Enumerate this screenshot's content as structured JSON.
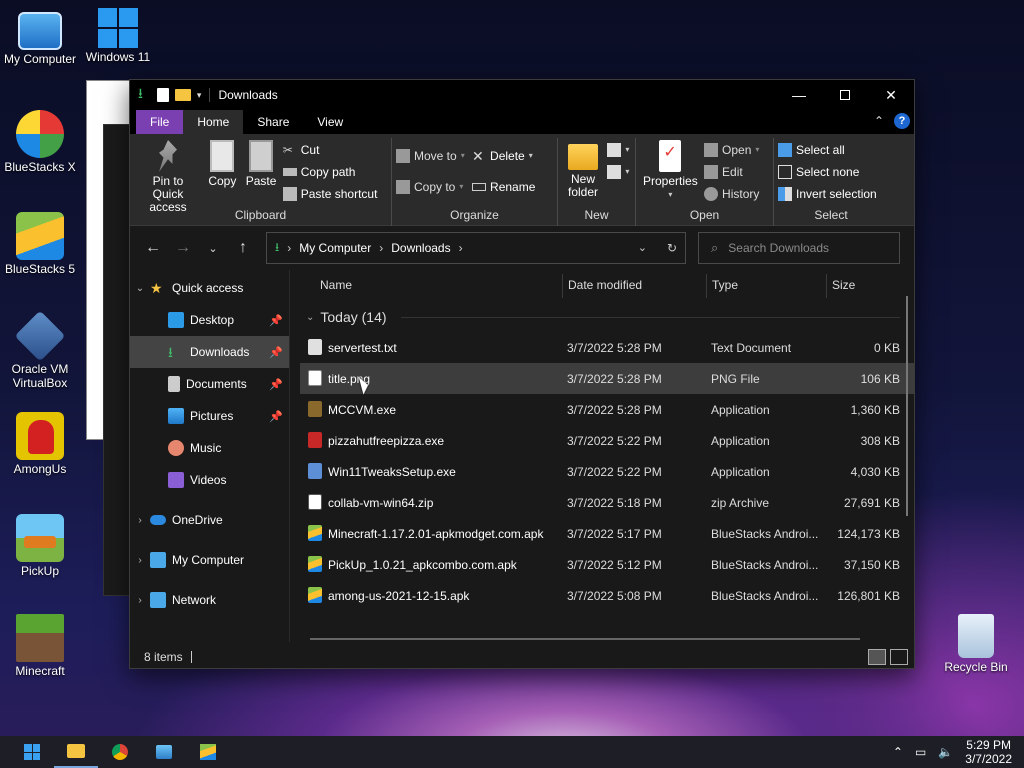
{
  "desktop": {
    "icons": [
      {
        "label": "My Computer",
        "icon": "monitor-icon"
      },
      {
        "label": "Windows 11",
        "icon": "windows-logo-icon"
      },
      {
        "label": "BlueStacks X",
        "icon": "bluestacks-x-icon"
      },
      {
        "label": "BlueStacks 5",
        "icon": "bluestacks-icon"
      },
      {
        "label": "Oracle VM VirtualBox",
        "icon": "virtualbox-icon"
      },
      {
        "label": "AmongUs",
        "icon": "among-us-icon"
      },
      {
        "label": "PickUp",
        "icon": "pickup-icon"
      },
      {
        "label": "Minecraft",
        "icon": "minecraft-icon"
      },
      {
        "label": "Recycle Bin",
        "icon": "recycle-bin-icon"
      }
    ]
  },
  "window": {
    "title": "Downloads",
    "tabs": {
      "file": "File",
      "home": "Home",
      "share": "Share",
      "view": "View"
    },
    "ribbon": {
      "clipboard": {
        "label": "Clipboard",
        "pin": "Pin to Quick access",
        "copy": "Copy",
        "paste": "Paste",
        "cut": "Cut",
        "copy_path": "Copy path",
        "paste_shortcut": "Paste shortcut"
      },
      "organize": {
        "label": "Organize",
        "move_to": "Move to",
        "copy_to": "Copy to",
        "delete": "Delete",
        "rename": "Rename"
      },
      "new": {
        "label": "New",
        "new_folder": "New folder"
      },
      "open": {
        "label": "Open",
        "properties": "Properties",
        "open": "Open",
        "edit": "Edit",
        "history": "History"
      },
      "select": {
        "label": "Select",
        "select_all": "Select all",
        "select_none": "Select none",
        "invert": "Invert selection"
      }
    },
    "address": {
      "root": "My Computer",
      "current": "Downloads"
    },
    "search": {
      "placeholder": "Search Downloads"
    },
    "nav": {
      "quick_access": "Quick access",
      "desktop": "Desktop",
      "downloads": "Downloads",
      "documents": "Documents",
      "pictures": "Pictures",
      "music": "Music",
      "videos": "Videos",
      "onedrive": "OneDrive",
      "my_computer": "My Computer",
      "network": "Network"
    },
    "columns": {
      "name": "Name",
      "date": "Date modified",
      "type": "Type",
      "size": "Size"
    },
    "group": "Today (14)",
    "files": [
      {
        "name": "servertest.txt",
        "date": "3/7/2022 5:28 PM",
        "type": "Text Document",
        "size": "0 KB",
        "icon": "text-file-icon"
      },
      {
        "name": "title.png",
        "date": "3/7/2022 5:28 PM",
        "type": "PNG File",
        "size": "106 KB",
        "icon": "image-file-icon"
      },
      {
        "name": "MCCVM.exe",
        "date": "3/7/2022 5:28 PM",
        "type": "Application",
        "size": "1,360 KB",
        "icon": "mccvm-app-icon"
      },
      {
        "name": "pizzahutfreepizza.exe",
        "date": "3/7/2022 5:22 PM",
        "type": "Application",
        "size": "308 KB",
        "icon": "pizza-app-icon"
      },
      {
        "name": "Win11TweaksSetup.exe",
        "date": "3/7/2022 5:22 PM",
        "type": "Application",
        "size": "4,030 KB",
        "icon": "setup-app-icon"
      },
      {
        "name": "collab-vm-win64.zip",
        "date": "3/7/2022 5:18 PM",
        "type": "zip Archive",
        "size": "27,691 KB",
        "icon": "zip-file-icon"
      },
      {
        "name": "Minecraft-1.17.2.01-apkmodget.com.apk",
        "date": "3/7/2022 5:17 PM",
        "type": "BlueStacks Androi...",
        "size": "124,173 KB",
        "icon": "apk-file-icon"
      },
      {
        "name": "PickUp_1.0.21_apkcombo.com.apk",
        "date": "3/7/2022 5:12 PM",
        "type": "BlueStacks Androi...",
        "size": "37,150 KB",
        "icon": "apk-file-icon"
      },
      {
        "name": "among-us-2021-12-15.apk",
        "date": "3/7/2022 5:08 PM",
        "type": "BlueStacks Androi...",
        "size": "126,801 KB",
        "icon": "apk-file-icon"
      }
    ],
    "status": "8 items"
  },
  "taskbar": {
    "time": "5:29 PM",
    "date": "3/7/2022"
  }
}
